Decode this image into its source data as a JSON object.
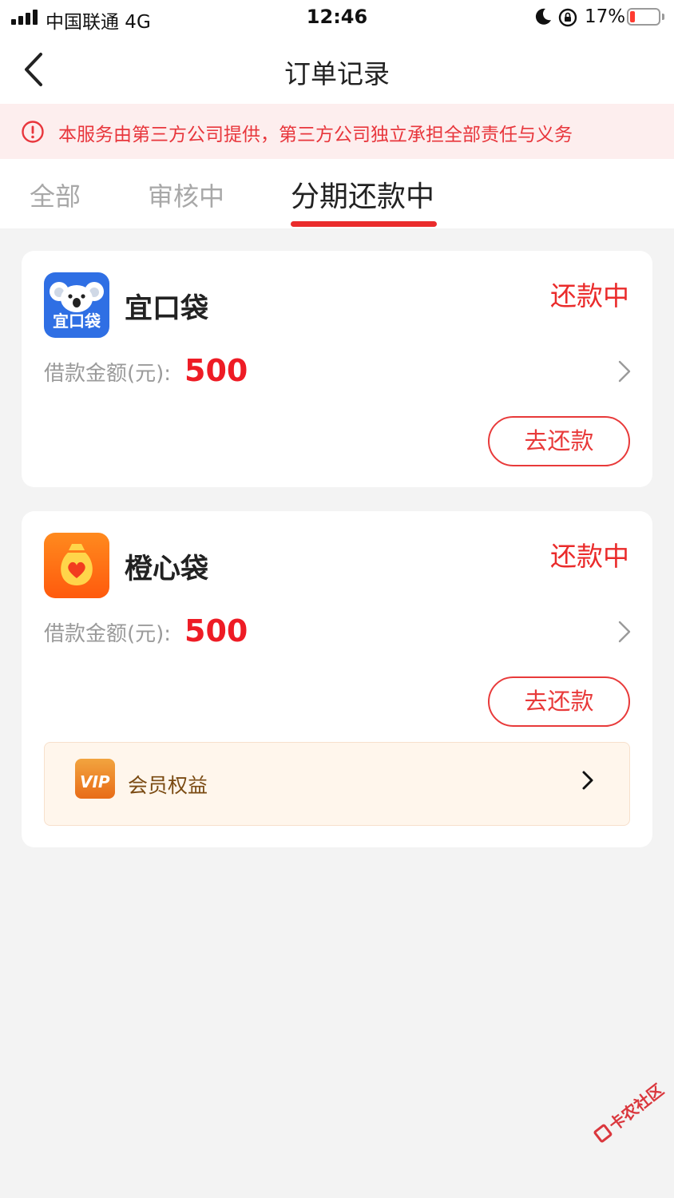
{
  "status_bar": {
    "carrier": "中国联通 4G",
    "time": "12:46",
    "battery_percent": "17%",
    "battery_level": 0.17,
    "icons": [
      "signal-icon",
      "moon-icon",
      "orientation-lock-icon",
      "battery-icon"
    ]
  },
  "nav": {
    "title": "订单记录",
    "back_icon": "chevron-left-icon"
  },
  "notice": {
    "icon": "alert-circle-icon",
    "text": "本服务由第三方公司提供，第三方公司独立承担全部责任与义务"
  },
  "tabs": [
    {
      "label": "全部",
      "active": false
    },
    {
      "label": "审核中",
      "active": false
    },
    {
      "label": "分期还款中",
      "active": true
    }
  ],
  "orders": [
    {
      "app_name": "宜口袋",
      "logo_text": "宜口袋",
      "status": "还款中",
      "amount_label": "借款金额(元):",
      "amount": "500",
      "button": "去还款"
    },
    {
      "app_name": "橙心袋",
      "status": "还款中",
      "amount_label": "借款金额(元):",
      "amount": "500",
      "button": "去还款",
      "vip": {
        "label": "会员权益",
        "badge": "VIP"
      }
    }
  ],
  "watermark": "卡农社区",
  "colors": {
    "accent_red": "#ea2b2b",
    "notice_bg": "#fdeeee",
    "page_bg": "#f3f3f3",
    "vip_bg": "#fff6ec"
  }
}
